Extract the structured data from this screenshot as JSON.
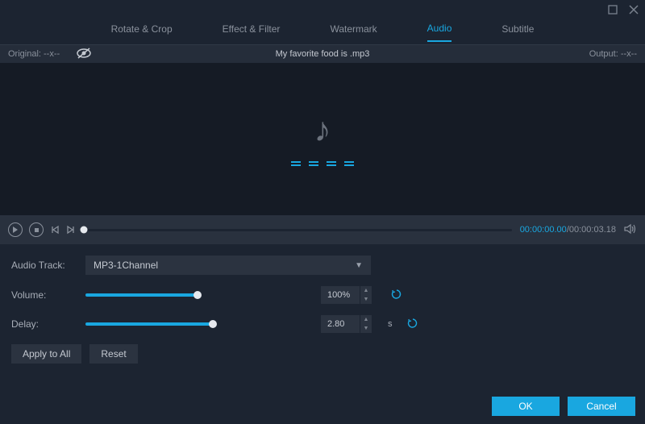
{
  "tabs": {
    "rotate": "Rotate & Crop",
    "effect": "Effect & Filter",
    "watermark": "Watermark",
    "audio": "Audio",
    "subtitle": "Subtitle"
  },
  "infobar": {
    "original": "Original: --x--",
    "filename": "My favorite food is .mp3",
    "output": "Output: --x--"
  },
  "playback": {
    "current": "00:00:00.00",
    "sep": "/",
    "total": "00:00:03.18"
  },
  "audio": {
    "track_label": "Audio Track:",
    "track_value": "MP3-1Channel",
    "volume_label": "Volume:",
    "volume_value": "100%",
    "volume_pct": 50,
    "delay_label": "Delay:",
    "delay_value": "2.80",
    "delay_pct": 57,
    "delay_unit": "s"
  },
  "buttons": {
    "apply_all": "Apply to All",
    "reset": "Reset",
    "ok": "OK",
    "cancel": "Cancel"
  }
}
